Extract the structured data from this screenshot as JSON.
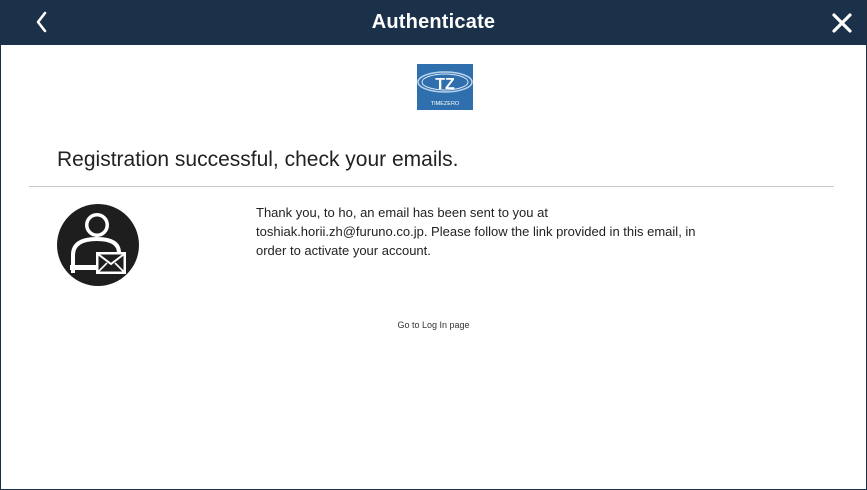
{
  "header": {
    "title": "Authenticate",
    "back_icon": "chevron-left-icon",
    "close_icon": "close-icon",
    "background_color": "#1b3049"
  },
  "logo": {
    "text_main": "TZ",
    "text_sub": "TIMEZERO",
    "color": "#2f6fad"
  },
  "main": {
    "headline": "Registration successful, check your emails.",
    "message_lines": [
      "Thank you, to ho, an email has been sent to you at",
      "toshiak.horii.zh@furuno.co.jp. Please follow the link provided in this email, in",
      "order to activate your account."
    ],
    "illustration_icon": "user-email-icon",
    "login_link": "Go to Log In page"
  }
}
